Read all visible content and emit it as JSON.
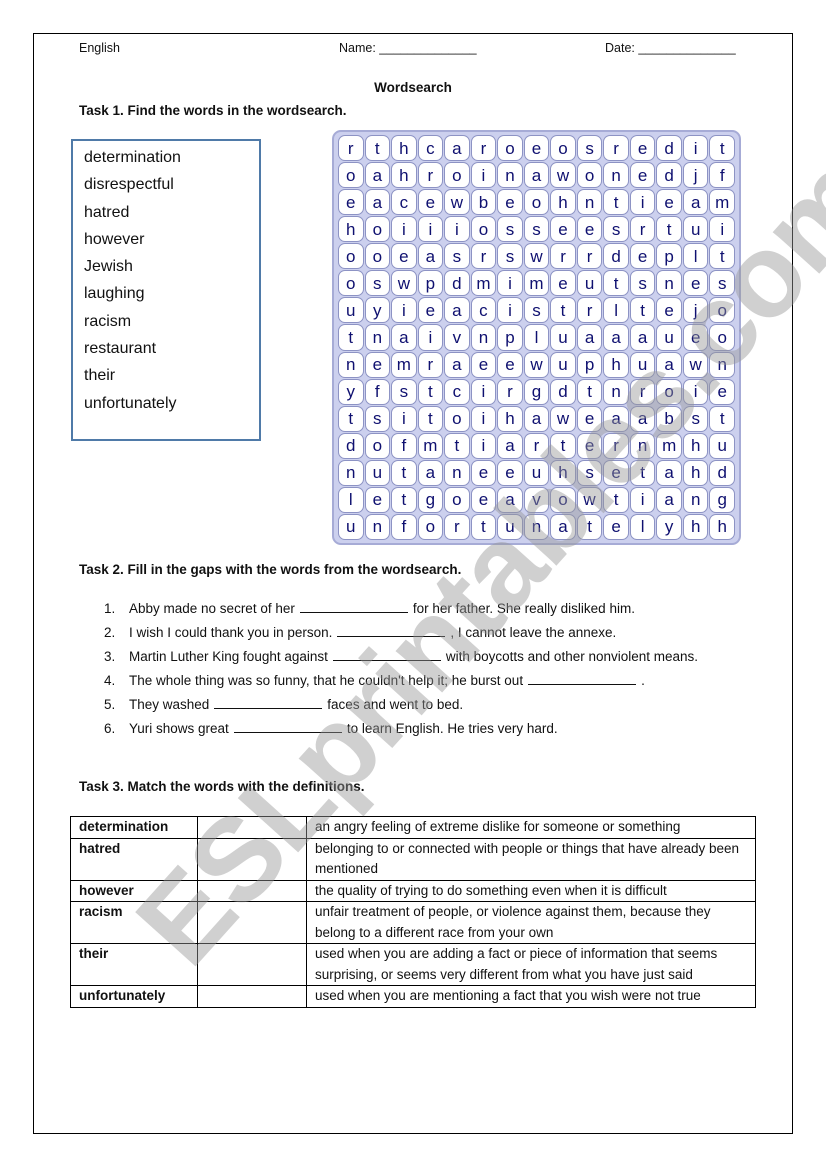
{
  "header": {
    "subject": "English",
    "name_label": "Name: ______________",
    "date_label": "Date: ______________"
  },
  "title": "Wordsearch",
  "task1": {
    "heading": "Task 1. Find the words in the wordsearch.",
    "words": [
      "determination",
      "disrespectful",
      "hatred",
      "however",
      "Jewish",
      "laughing",
      "racism",
      "restaurant",
      "their",
      "unfortunately"
    ],
    "grid": [
      "rthcaroeosredit",
      "oahroinawonedjf",
      "eacewbeohntieam",
      "hoiiiosseesrtui",
      "ooeasrswrrdeplt",
      "oswpdmimeutsnes",
      "uyieacistrltejo",
      "tnaivnpluaaaueo",
      "nemraeewuphuawn",
      "yfstcirgdtnroie",
      "tsitoihaweaabst",
      "dofmtiarternmhu",
      "nutaneeuhsetahd",
      "letgoeavowtiang",
      "unfortunatelyhh"
    ],
    "colors": {
      "cell_text": "#0f1070",
      "grid_bg": "#ccd0ee",
      "box_border": "#4f7aa8"
    }
  },
  "task2": {
    "heading": "Task 2. Fill in the gaps with the words from the wordsearch.",
    "sentences": [
      {
        "before": "Abby made no secret of her",
        "after": "for her father. She really disliked him."
      },
      {
        "before": "I wish I could thank you in person.",
        "after": ", I cannot leave the annexe."
      },
      {
        "before": "Martin Luther King fought against",
        "after": "with boycotts and other nonviolent means."
      },
      {
        "before": "The whole thing was so funny, that he couldn't help it; he burst out",
        "after": "."
      },
      {
        "before": "They washed",
        "after": "faces and went to bed."
      },
      {
        "before": "Yuri shows great",
        "after": "to learn English. He tries very hard."
      }
    ]
  },
  "task3": {
    "heading": "Task 3. Match the words with the definitions.",
    "rows": [
      {
        "word": "determination",
        "definition": "an angry feeling of extreme dislike for someone or something"
      },
      {
        "word": "hatred",
        "definition": "belonging to or connected with people or things that have already been mentioned"
      },
      {
        "word": "however",
        "definition": "the quality of trying to do something even when it is difficult"
      },
      {
        "word": "racism",
        "definition": "unfair treatment of people, or violence against them, because they belong to a different race from your own"
      },
      {
        "word": "their",
        "definition": "used when you are adding a fact or piece of information that seems surprising, or seems very different from what you have just said"
      },
      {
        "word": "unfortunately",
        "definition": "used when you are mentioning a fact that you wish were not true"
      }
    ]
  },
  "watermark": "ESLprintables.com"
}
